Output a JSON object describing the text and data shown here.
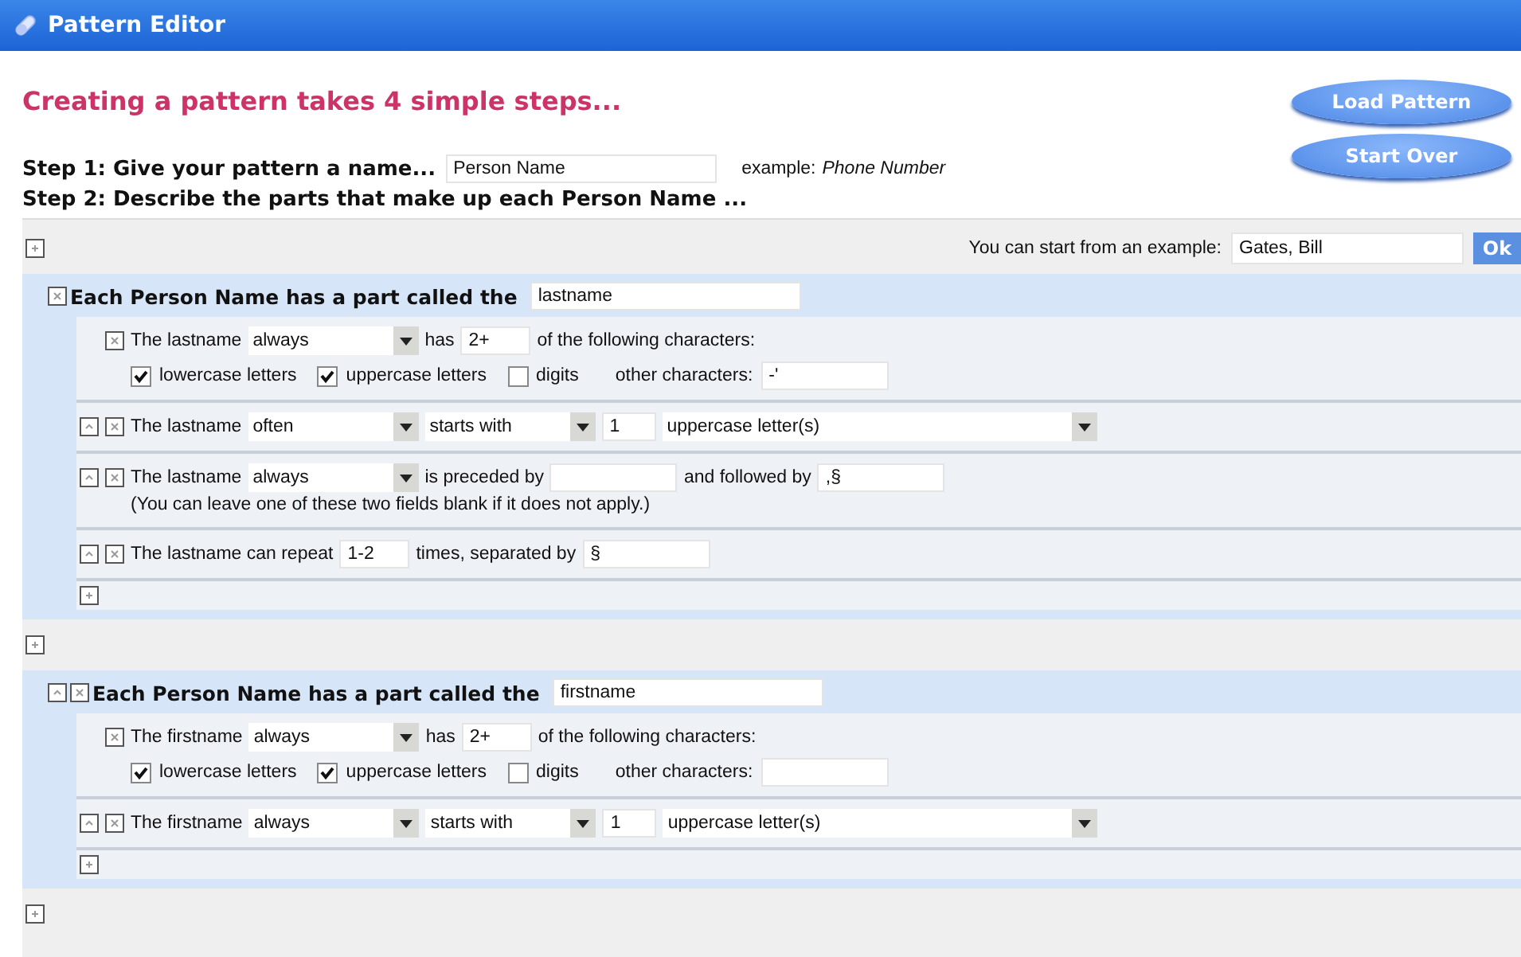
{
  "window": {
    "title": "Pattern Editor"
  },
  "heading": "Creating a pattern takes 4 simple steps...",
  "buttons": [
    {
      "label": "Load Pattern"
    },
    {
      "label": "Start Over"
    }
  ],
  "step1": {
    "label": "Step 1: Give your pattern a name...",
    "value": "Person Name",
    "example_label": "example:",
    "example_value": "Phone Number"
  },
  "step2": {
    "label": "Step 2: Describe the parts that make up each Person Name ..."
  },
  "example_row": {
    "label": "You can start from an example:",
    "value": "Gates, Bill",
    "ok": "Ok"
  },
  "parts": [
    {
      "label": "Each Person Name has a part called the",
      "name": "lastname",
      "movable": false,
      "rules": [
        {
          "kind": "charset",
          "movable": false,
          "subject": "The lastname",
          "frequency": "always",
          "verb": "has",
          "count": "2+",
          "tail": "of the following characters:",
          "options": [
            {
              "label": "lowercase letters",
              "checked": true
            },
            {
              "label": "uppercase letters",
              "checked": true
            },
            {
              "label": "digits",
              "checked": false
            }
          ],
          "other_label": "other characters:",
          "other_value": "-'"
        },
        {
          "kind": "starts",
          "movable": true,
          "subject": "The lastname",
          "frequency": "often",
          "verb": "starts with",
          "count": "1",
          "unit": "uppercase letter(s)"
        },
        {
          "kind": "surround",
          "movable": true,
          "subject": "The lastname",
          "frequency": "always",
          "verb": "is preceded by",
          "after_label": "and followed by",
          "after": ",§",
          "note": "(You can leave one of these two fields blank if it does not apply.)"
        },
        {
          "kind": "repeat",
          "movable": true,
          "subject": "The lastname can repeat",
          "count": "1-2",
          "middle": "times, separated by",
          "separator": "§"
        }
      ]
    },
    {
      "label": "Each Person Name has a part called the",
      "name": "firstname",
      "movable": true,
      "rules": [
        {
          "kind": "charset",
          "movable": false,
          "subject": "The firstname",
          "frequency": "always",
          "verb": "has",
          "count": "2+",
          "tail": "of the following characters:",
          "options": [
            {
              "label": "lowercase letters",
              "checked": true
            },
            {
              "label": "uppercase letters",
              "checked": true
            },
            {
              "label": "digits",
              "checked": false
            }
          ],
          "other_label": "other characters:"
        },
        {
          "kind": "starts",
          "movable": true,
          "subject": "The firstname",
          "frequency": "always",
          "verb": "starts with",
          "count": "1",
          "unit": "uppercase letter(s)"
        }
      ]
    }
  ]
}
